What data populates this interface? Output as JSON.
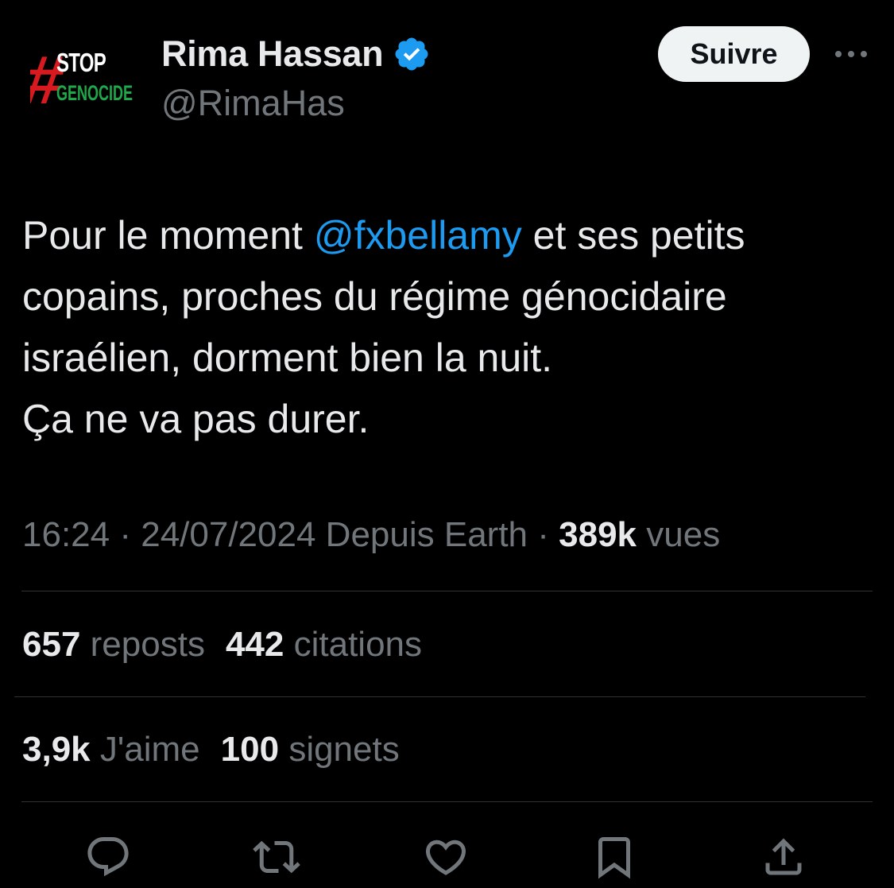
{
  "author": {
    "avatar_text_top": "STOP",
    "avatar_text_bottom": "GENOCIDE",
    "avatar_hash": "#",
    "display_name": "Rima Hassan",
    "handle": "@RimaHas",
    "verified": true
  },
  "follow_label": "Suivre",
  "tweet": {
    "line1_pre": "Pour le moment ",
    "mention": "@fxbellamy",
    "line1_post": " et ses petits",
    "line2": "copains, proches du régime génocidaire",
    "line3": "israélien, dorment bien la nuit.",
    "line4": "Ça ne va pas durer."
  },
  "meta": {
    "time": "16:24",
    "separator": " · ",
    "date": "24/07/2024",
    "source": "Depuis Earth",
    "views_count": "389k",
    "views_label": "vues"
  },
  "stats": {
    "reposts_count": "657",
    "reposts_label": "reposts",
    "quotes_count": "442",
    "quotes_label": "citations",
    "likes_count": "3,9k",
    "likes_label": "J'aime",
    "bookmarks_count": "100",
    "bookmarks_label": "signets"
  },
  "colors": {
    "background": "#000000",
    "text": "#e7e9ea",
    "secondary": "#71767b",
    "accent": "#1d9bf0",
    "divider": "#2f3336",
    "follow_bg": "#eff3f4",
    "avatar_red": "#d71920",
    "avatar_green": "#1fa84a"
  },
  "icons": [
    "verified-badge-icon",
    "more-icon",
    "reply-icon",
    "repost-icon",
    "like-icon",
    "bookmark-icon",
    "share-icon"
  ]
}
